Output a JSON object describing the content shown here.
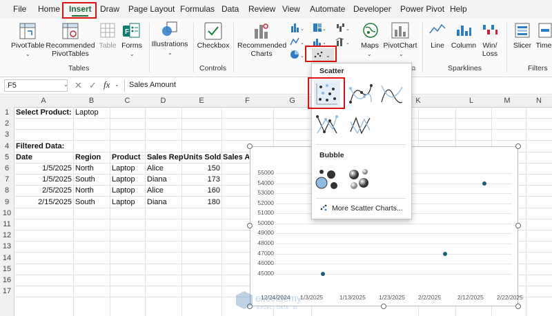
{
  "menu": [
    "File",
    "Home",
    "Insert",
    "Draw",
    "Page Layout",
    "Formulas",
    "Data",
    "Review",
    "View",
    "Automate",
    "Developer",
    "Power Pivot",
    "Help"
  ],
  "ribbon": {
    "pivottable": "PivotTable",
    "recommended_pivottables_1": "Recommended",
    "recommended_pivottables_2": "PivotTables",
    "table": "Table",
    "forms": "Forms",
    "illustrations": "Illustrations",
    "checkbox": "Checkbox",
    "recommended_charts_1": "Recommended",
    "recommended_charts_2": "Charts",
    "maps": "Maps",
    "pivotchart": "PivotChart",
    "line": "Line",
    "column": "Column",
    "winloss_1": "Win/",
    "winloss_2": "Loss",
    "slicer": "Slicer",
    "time": "Time",
    "group_tables": "Tables",
    "group_controls": "Controls",
    "group_sparklines": "Sparklines",
    "group_filters": "Filters"
  },
  "formula_bar": {
    "name_box": "F5",
    "fx": "fx",
    "formula": "Sales Amount"
  },
  "columns": [
    "A",
    "B",
    "C",
    "D",
    "E",
    "F",
    "G",
    "H",
    "I",
    "J",
    "K",
    "L",
    "M",
    "N"
  ],
  "rows": [
    "1",
    "2",
    "3",
    "4",
    "5",
    "6",
    "7",
    "8",
    "9",
    "10",
    "11",
    "12",
    "13",
    "14",
    "15",
    "16",
    "17"
  ],
  "cells": {
    "a1": "Select Product:",
    "b1": "Laptop",
    "a4": "Filtered Data:",
    "a5": "Date",
    "b5": "Region",
    "c5": "Product",
    "d5": "Sales Rep",
    "e5": "Units Sold",
    "f5": "Sales A",
    "table": [
      [
        "1/5/2025",
        "North",
        "Laptop",
        "Alice",
        "150"
      ],
      [
        "1/5/2025",
        "South",
        "Laptop",
        "Diana",
        "173"
      ],
      [
        "2/5/2025",
        "North",
        "Laptop",
        "Alice",
        "160"
      ],
      [
        "2/15/2025",
        "South",
        "Laptop",
        "Diana",
        "180"
      ]
    ]
  },
  "dropdown": {
    "scatter_header": "Scatter",
    "bubble_header": "Bubble",
    "more": "More Scatter Charts..."
  },
  "chart_data": {
    "type": "scatter",
    "title_fragment": "t",
    "x_ticks": [
      "12/24/2024",
      "1/3/2025",
      "1/13/2025",
      "1/23/2025",
      "2/2/2025",
      "2/12/2025",
      "2/22/2025"
    ],
    "y_ticks": [
      "45000",
      "46000",
      "47000",
      "48000",
      "49000",
      "50000",
      "51000",
      "52000",
      "53000",
      "54000",
      "55000"
    ],
    "ylim": [
      44500,
      55000
    ],
    "points": [
      {
        "x": "1/5/2025",
        "y": 45000
      },
      {
        "x": "2/5/2025",
        "y": 47000
      },
      {
        "x": "2/15/2025",
        "y": 54000
      }
    ]
  },
  "watermark": {
    "brand": "exceldemy",
    "tagline": "EXCEL · DATA · BI"
  }
}
